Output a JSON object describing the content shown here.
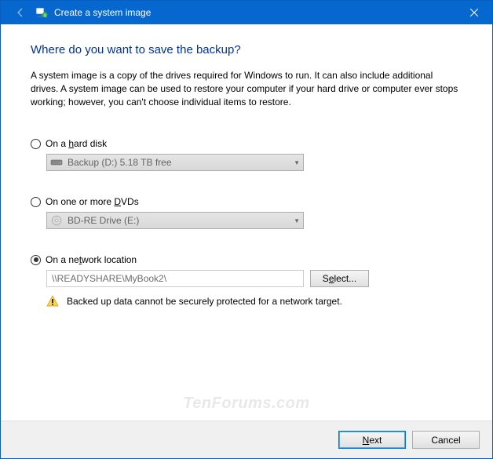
{
  "titlebar": {
    "title": "Create a system image"
  },
  "main": {
    "heading": "Where do you want to save the backup?",
    "description": "A system image is a copy of the drives required for Windows to run. It can also include additional drives. A system image can be used to restore your computer if your hard drive or computer ever stops working; however, you can't choose individual items to restore."
  },
  "options": {
    "hard_disk": {
      "label_pre": "On a ",
      "label_m": "h",
      "label_post": "ard disk",
      "checked": false,
      "dropdown_text": "Backup (D:)  5.18 TB free"
    },
    "dvds": {
      "label_pre": "On one or more ",
      "label_m": "D",
      "label_post": "VDs",
      "checked": false,
      "dropdown_text": "BD-RE Drive (E:)"
    },
    "network": {
      "label_pre": "On a ne",
      "label_m": "t",
      "label_post": "work location",
      "checked": true,
      "path": "\\\\READYSHARE\\MyBook2\\",
      "select_pre": "S",
      "select_m": "e",
      "select_post": "lect...",
      "warning_text": "Backed up data cannot be securely protected for a network target."
    }
  },
  "footer": {
    "next_m": "N",
    "next_post": "ext",
    "cancel": "Cancel"
  },
  "watermark": "TenForums.com"
}
